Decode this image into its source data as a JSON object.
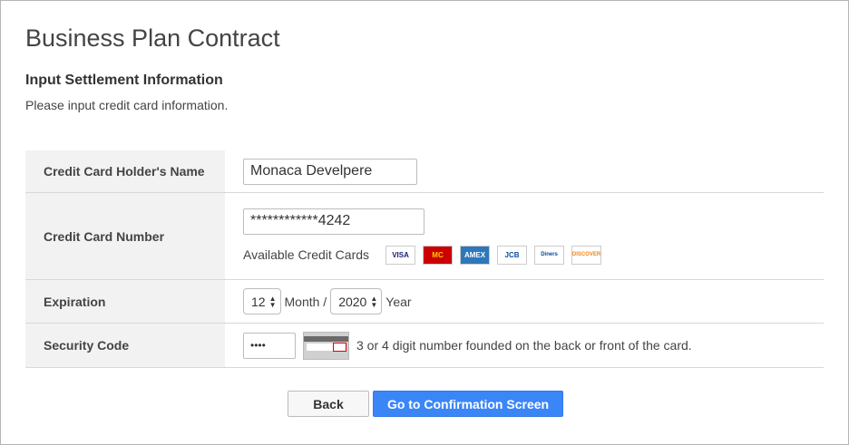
{
  "page": {
    "title": "Business Plan Contract",
    "section_title": "Input Settlement Information",
    "description": "Please input credit card information."
  },
  "form": {
    "holder_name": {
      "label": "Credit Card Holder's Name",
      "value": "Monaca Develpere"
    },
    "card_number": {
      "label": "Credit Card Number",
      "value": "************4242",
      "available_label": "Available Credit Cards",
      "cards": [
        {
          "name": "visa-card-icon",
          "text": "VISA",
          "bg": "#ffffff",
          "fg": "#1a1f71"
        },
        {
          "name": "mastercard-card-icon",
          "text": "MC",
          "bg": "#cc0000",
          "fg": "#ffcc00"
        },
        {
          "name": "amex-card-icon",
          "text": "AMEX",
          "bg": "#2e77bb",
          "fg": "#ffffff"
        },
        {
          "name": "jcb-card-icon",
          "text": "JCB",
          "bg": "#ffffff",
          "fg": "#0b4ea2"
        },
        {
          "name": "diners-club-card-icon",
          "text": "Diners",
          "bg": "#ffffff",
          "fg": "#004a97"
        },
        {
          "name": "discover-card-icon",
          "text": "DISCOVER",
          "bg": "#ffffff",
          "fg": "#f58220"
        }
      ]
    },
    "expiration": {
      "label": "Expiration",
      "month": "12",
      "month_label": "Month /",
      "year": "2020",
      "year_label": "Year"
    },
    "security_code": {
      "label": "Security Code",
      "value": "••••",
      "hint": "3 or 4 digit number founded on the back or front of the card."
    }
  },
  "buttons": {
    "back": "Back",
    "confirm": "Go to Confirmation Screen"
  },
  "colors": {
    "primary_button": "#3b86f7",
    "label_background": "#f2f2f2"
  }
}
